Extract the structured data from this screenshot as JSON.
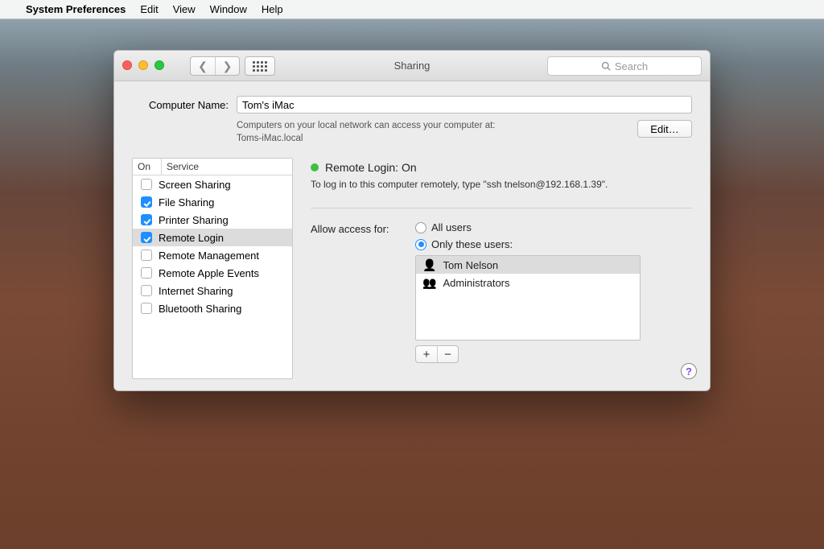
{
  "menubar": {
    "app": "System Preferences",
    "items": [
      "Edit",
      "View",
      "Window",
      "Help"
    ]
  },
  "window": {
    "title": "Sharing",
    "search_placeholder": "Search"
  },
  "computer_name": {
    "label": "Computer Name:",
    "value": "Tom's iMac",
    "help_line1": "Computers on your local network can access your computer at:",
    "help_line2": "Toms-iMac.local",
    "edit_label": "Edit…"
  },
  "services": {
    "head_on": "On",
    "head_service": "Service",
    "items": [
      {
        "on": false,
        "label": "Screen Sharing",
        "selected": false
      },
      {
        "on": true,
        "label": "File Sharing",
        "selected": false
      },
      {
        "on": true,
        "label": "Printer Sharing",
        "selected": false
      },
      {
        "on": true,
        "label": "Remote Login",
        "selected": true
      },
      {
        "on": false,
        "label": "Remote Management",
        "selected": false
      },
      {
        "on": false,
        "label": "Remote Apple Events",
        "selected": false
      },
      {
        "on": false,
        "label": "Internet Sharing",
        "selected": false
      },
      {
        "on": false,
        "label": "Bluetooth Sharing",
        "selected": false
      }
    ]
  },
  "detail": {
    "status_title": "Remote Login: On",
    "status_sub": "To log in to this computer remotely, type \"ssh tnelson@192.168.1.39\".",
    "access_label": "Allow access for:",
    "radio_all": "All users",
    "radio_only": "Only these users:",
    "radio_selected": "only",
    "users": [
      {
        "name": "Tom Nelson",
        "type": "single",
        "selected": true
      },
      {
        "name": "Administrators",
        "type": "group",
        "selected": false
      }
    ],
    "plus": "+",
    "minus": "−"
  }
}
